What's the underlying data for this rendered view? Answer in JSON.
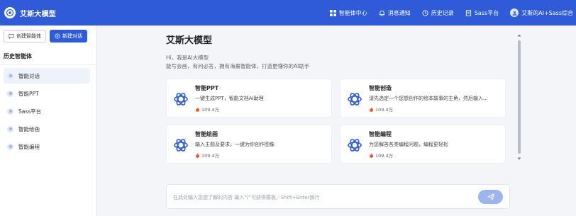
{
  "header": {
    "brand_name": "艾斯大模型",
    "nav": [
      {
        "label": "智能体中心",
        "icon": "grid-icon"
      },
      {
        "label": "消息通知",
        "icon": "bell-icon"
      },
      {
        "label": "历史记录",
        "icon": "clock-icon"
      },
      {
        "label": "Sass平台",
        "icon": "document-icon"
      }
    ],
    "user_name": "艾斯的AI+Sass综合"
  },
  "sidebar": {
    "create_agent_label": "创建智能体",
    "new_chat_label": "新建对话",
    "history_title": "历史智能体",
    "items": [
      {
        "label": "智能对话",
        "active": true
      },
      {
        "label": "智能PPT",
        "active": false
      },
      {
        "label": "Sass平台",
        "active": false
      },
      {
        "label": "智能绘画",
        "active": false
      },
      {
        "label": "智能编程",
        "active": false
      }
    ]
  },
  "main": {
    "title": "艾斯大模型",
    "intro_line1": "Hi，我是AI大模型",
    "intro_line2": "能写会画，有问必答，拥有海量智能体，打造更懂你的AI助手",
    "cards": [
      {
        "title": "智能PPT",
        "desc": "一键生成PPT，智能文档AI助理",
        "count": "109.4万"
      },
      {
        "title": "智能创造",
        "desc": "请先选定一个您想创作的绘本故事的主角，然后输入...",
        "count": "109.4万"
      },
      {
        "title": "智能绘画",
        "desc": "输入主题及要求，一键为你创作图像",
        "count": "109.4万"
      },
      {
        "title": "智能编程",
        "desc": "为您解答各类编程问题，编程更轻松",
        "count": "109.4万"
      }
    ],
    "input_placeholder": "在此处输入您想了解的内容  输入“/”可获得模板，Shift+Enter换行"
  },
  "colors": {
    "brand": "#2f5bd8",
    "send_button": "#9db5ee",
    "fire": "#f04a2a"
  }
}
